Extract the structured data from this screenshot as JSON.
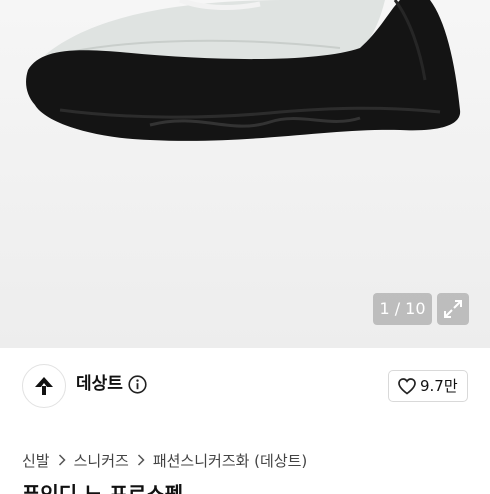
{
  "gallery": {
    "counter": "1 / 10",
    "counter_current": 1,
    "counter_total": 10
  },
  "store": {
    "name": "데상트",
    "likes": "9.7만",
    "icons": {
      "logo": "descente-arrow-logo",
      "info": "info-circle-icon",
      "like": "heart-outline-icon"
    }
  },
  "breadcrumb": [
    "신발",
    "스니커즈",
    "패션스니커즈화 (데상트)"
  ],
  "product": {
    "title_partial": "푸인디 노 프로스펙"
  },
  "colors": {
    "accent_text": "#111111",
    "overlay": "#969696"
  }
}
